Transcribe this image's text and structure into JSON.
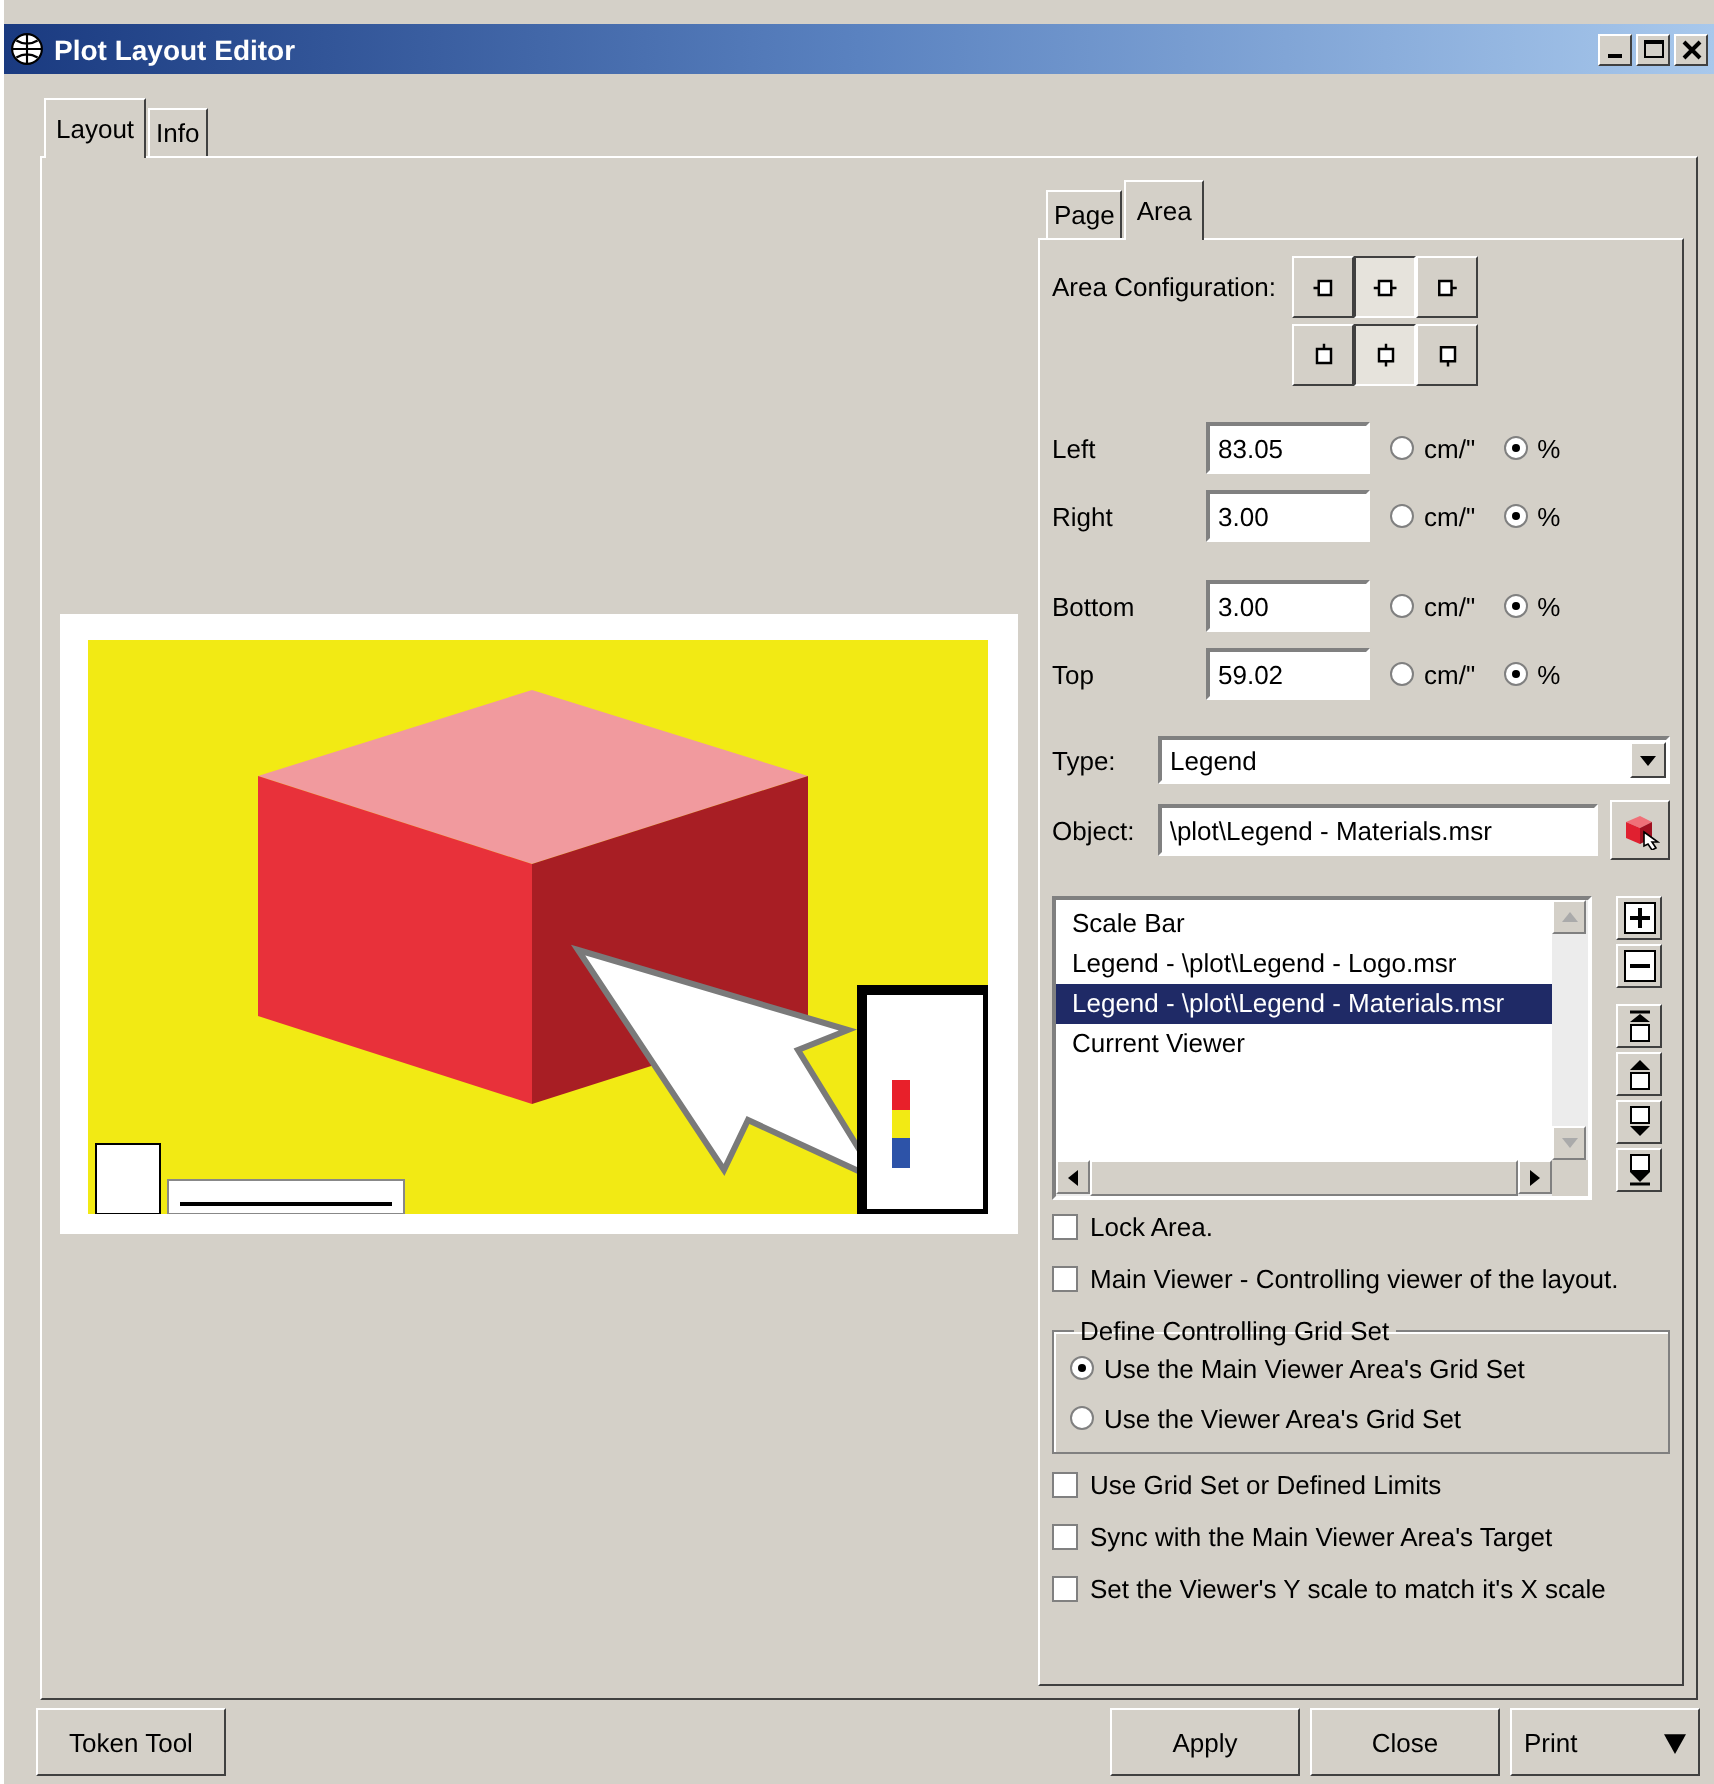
{
  "window": {
    "title": "Plot Layout Editor"
  },
  "outer_tabs": [
    {
      "label": "Layout",
      "selected": true
    },
    {
      "label": "Info",
      "selected": false
    }
  ],
  "inner_tabs": [
    {
      "label": "Page",
      "selected": false
    },
    {
      "label": "Area",
      "selected": true
    }
  ],
  "area_configuration": {
    "label": "Area Configuration:",
    "horizontal": [
      {
        "kind": "left",
        "selected": false
      },
      {
        "kind": "center",
        "selected": true
      },
      {
        "kind": "right",
        "selected": false
      }
    ],
    "vertical": [
      {
        "kind": "top",
        "selected": false
      },
      {
        "kind": "middle",
        "selected": true
      },
      {
        "kind": "bottom",
        "selected": false
      }
    ]
  },
  "margins": [
    {
      "label": "Left",
      "value": "83.05",
      "units": [
        {
          "label": "cm/\"",
          "selected": false
        },
        {
          "label": "%",
          "selected": true
        }
      ]
    },
    {
      "label": "Right",
      "value": "3.00",
      "units": [
        {
          "label": "cm/\"",
          "selected": false
        },
        {
          "label": "%",
          "selected": true
        }
      ]
    },
    {
      "label": "Bottom",
      "value": "3.00",
      "units": [
        {
          "label": "cm/\"",
          "selected": false
        },
        {
          "label": "%",
          "selected": true
        }
      ]
    },
    {
      "label": "Top",
      "value": "59.02",
      "units": [
        {
          "label": "cm/\"",
          "selected": false
        },
        {
          "label": "%",
          "selected": true
        }
      ]
    }
  ],
  "type": {
    "label": "Type:",
    "value": "Legend"
  },
  "object": {
    "label": "Object:",
    "value": "\\plot\\Legend - Materials.msr"
  },
  "areas": [
    {
      "label": "Scale Bar",
      "selected": false
    },
    {
      "label": "Legend - \\plot\\Legend - Logo.msr",
      "selected": false
    },
    {
      "label": "Legend - \\plot\\Legend - Materials.msr",
      "selected": true
    },
    {
      "label": "Current Viewer",
      "selected": false
    }
  ],
  "options_top": [
    {
      "label": "Lock Area.",
      "checked": false
    },
    {
      "label": "Main Viewer - Controlling viewer of the layout.",
      "checked": false
    }
  ],
  "grid_set": {
    "title": "Define Controlling Grid Set",
    "options": [
      {
        "label": "Use the Main Viewer Area's Grid Set",
        "selected": true
      },
      {
        "label": "Use the Viewer Area's Grid Set",
        "selected": false
      }
    ]
  },
  "options_bottom": [
    {
      "label": "Use Grid Set or Defined Limits",
      "checked": false
    },
    {
      "label": "Sync with the Main Viewer Area's Target",
      "checked": false
    },
    {
      "label": "Set the Viewer's Y scale to match it's X scale",
      "checked": false
    }
  ],
  "footer": {
    "left_button": "Token Tool",
    "buttons": [
      {
        "label": "Apply",
        "kind": "plain"
      },
      {
        "label": "Close",
        "kind": "plain"
      },
      {
        "label": "Print",
        "kind": "dropdown"
      }
    ]
  }
}
